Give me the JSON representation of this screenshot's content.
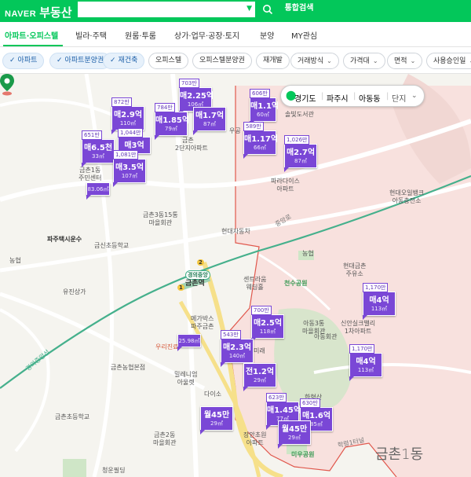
{
  "header": {
    "brand": "NAVER",
    "title": "부동산",
    "search_placeholder": "",
    "integrated_search": "통합검색"
  },
  "nav": {
    "items": [
      {
        "label": "아파트·오피스텔",
        "active": true
      },
      {
        "label": "빌라·주택"
      },
      {
        "label": "원룸·투룸"
      },
      {
        "label": "상가·업무·공장·토지"
      },
      {
        "label": "분양"
      },
      {
        "label": "MY관심"
      }
    ]
  },
  "filters": [
    {
      "label": "아파트",
      "on": true
    },
    {
      "label": "아파트분양권",
      "on": true
    },
    {
      "label": "재건축",
      "on": true
    },
    {
      "label": "오피스텔"
    },
    {
      "label": "오피스텔분양권"
    },
    {
      "label": "재개발"
    },
    {
      "label": "거래방식",
      "dropdown": true
    },
    {
      "label": "가격대",
      "dropdown": true
    },
    {
      "label": "면적",
      "dropdown": true
    },
    {
      "label": "사용승인일",
      "dropdown": true
    }
  ],
  "location": {
    "province": "경기도",
    "city": "파주시",
    "dong": "아동동",
    "unit": "단지"
  },
  "markers": [
    {
      "count": "703만",
      "price": "매2.25억",
      "area": "106㎡"
    },
    {
      "count": "872만",
      "price": "매2.9억",
      "area": "110㎡"
    },
    {
      "count": "784만",
      "price": "매1.85억",
      "area": "79㎡"
    },
    {
      "count": "",
      "price": "매1.7억",
      "area": "87㎡"
    },
    {
      "count": "606만",
      "price": "매1.1억",
      "area": "60㎡"
    },
    {
      "count": "651만",
      "price": "매6.5천",
      "area": "33㎡"
    },
    {
      "count": "1,044만",
      "price": "매3억",
      "area": ""
    },
    {
      "count": "1,081만",
      "price": "매3.5억",
      "area": "107㎡"
    },
    {
      "count": "",
      "price": "",
      "area": "83.06㎡"
    },
    {
      "count": "589만",
      "price": "매1.17억",
      "area": "66㎡"
    },
    {
      "count": "1,026만",
      "price": "매2.7억",
      "area": "87㎡"
    },
    {
      "count": "1,170만",
      "price": "매4억",
      "area": "113㎡"
    },
    {
      "count": "700만",
      "price": "매2.5억",
      "area": "118㎡"
    },
    {
      "count": "543만",
      "price": "매2.3억",
      "area": "140㎡"
    },
    {
      "count": "",
      "price": "",
      "area": "25.98㎡"
    },
    {
      "count": "1,170만",
      "price": "매4억",
      "area": "113㎡"
    },
    {
      "count": "",
      "price": "전1.2억",
      "area": "29㎡"
    },
    {
      "count": "623만",
      "price": "매1.45억",
      "area": "77㎡"
    },
    {
      "count": "630만",
      "price": "매1.6억",
      "area": "85㎡"
    },
    {
      "count": "",
      "price": "월45만",
      "area": "29㎡"
    },
    {
      "count": "",
      "price": "월45만",
      "area": "29㎡"
    }
  ],
  "places": {
    "p01": "금촌1동\n주민센터",
    "p02": "금촌",
    "p03": "2단지아파트",
    "p04": "솔빛도서관",
    "p05": "우공",
    "p06": "파라다이스\n아파트",
    "p07": "현대오일뱅크\n아동충전소",
    "p08": "금촌3동15통\n마을회관",
    "p09": "파주택시운수",
    "p10": "현대자동차",
    "p11": "금신초등학교",
    "p12": "농협",
    "p13": "농협",
    "p14": "현대금촌\n주유소",
    "p15": "센트라움\n웨딩홀",
    "p16": "천수공원",
    "p17": "경의중앙",
    "p18": "금촌역",
    "p19": "유진상가",
    "p20": "메가박스\n파주금촌",
    "p21": "아동3통\n마을회관",
    "p22": "신안실크밸리\n1차아파트",
    "p23": "우리진료",
    "p24": "금촌농협본점",
    "p25": "밀레니엄\n아울렛",
    "p26": "다이소",
    "p27": "금촌초등학교",
    "p28": "금촌2동\n마을회관",
    "p29": "장안초원\n아파트",
    "p30": "미우공원",
    "p31": "청운필딩",
    "p32": "금촌1동",
    "p33": "경의중앙선",
    "p34": "중앙로",
    "p35": "아동회관",
    "p36": "학령1터널",
    "p37": "미래",
    "p38": "한형산",
    "p39": "1",
    "p40": "2"
  }
}
